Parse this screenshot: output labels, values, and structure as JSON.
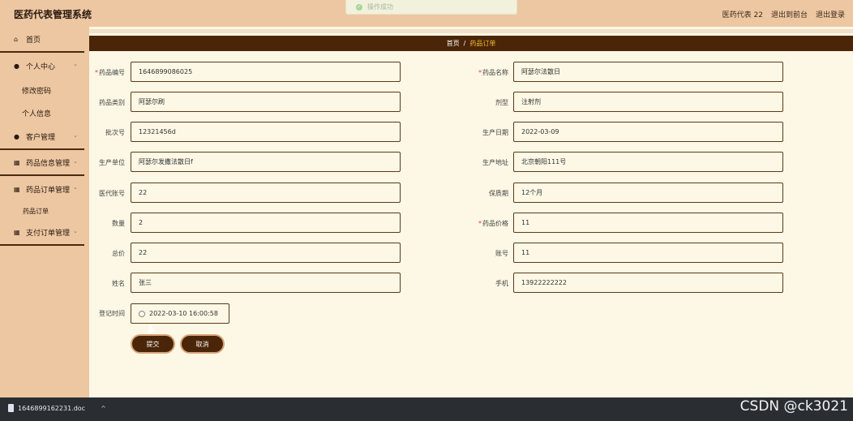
{
  "header": {
    "title": "医药代表管理系统",
    "user": "医药代表 22",
    "to_front": "退出到前台",
    "logout": "退出登录"
  },
  "toast": {
    "text": "操作成功"
  },
  "sidebar": {
    "items": [
      {
        "label": "首页",
        "icon": "home-icon"
      },
      {
        "label": "个人中心",
        "icon": "user-icon"
      },
      {
        "label": "修改密码"
      },
      {
        "label": "个人信息"
      },
      {
        "label": "客户管理",
        "icon": "user-icon"
      },
      {
        "label": "药品信息管理",
        "icon": "grid-icon"
      },
      {
        "label": "药品订单管理",
        "icon": "grid-icon"
      },
      {
        "label": "药品订单"
      },
      {
        "label": "支付订单管理",
        "icon": "grid-icon"
      }
    ]
  },
  "breadcrumb": {
    "home": "首页",
    "sep": "/",
    "current": "药品订单"
  },
  "form": {
    "drug_no": {
      "label": "药品编号",
      "value": "1646899086025",
      "required": true
    },
    "drug_name": {
      "label": "药品名称",
      "value": "阿瑟尔法散日",
      "required": true
    },
    "drug_category": {
      "label": "药品类别",
      "value": "阿瑟尔刷"
    },
    "dosage_form": {
      "label": "剂型",
      "value": "注射剂"
    },
    "batch_no": {
      "label": "批次号",
      "value": "12321456d"
    },
    "production_date": {
      "label": "生产日期",
      "value": "2022-03-09"
    },
    "manufacturer": {
      "label": "生产单位",
      "value": "阿瑟尔发撒法散日f"
    },
    "production_address": {
      "label": "生产地址",
      "value": "北京朝阳111号"
    },
    "rep_account": {
      "label": "医代账号",
      "value": "22"
    },
    "shelf_life": {
      "label": "保质期",
      "value": "12个月"
    },
    "quantity": {
      "label": "数量",
      "value": "2"
    },
    "drug_price": {
      "label": "药品价格",
      "value": "11",
      "required": true
    },
    "total": {
      "label": "总价",
      "value": "22"
    },
    "account": {
      "label": "账号",
      "value": "11"
    },
    "name": {
      "label": "姓名",
      "value": "张三"
    },
    "phone": {
      "label": "手机",
      "value": "13922222222"
    },
    "register_time": {
      "label": "登记时间",
      "value": "2022-03-10 16:00:58"
    }
  },
  "buttons": {
    "submit": "提交",
    "cancel": "取消"
  },
  "taskbar": {
    "download_file": "1646899162231.doc"
  },
  "watermark": "CSDN @ck3021"
}
